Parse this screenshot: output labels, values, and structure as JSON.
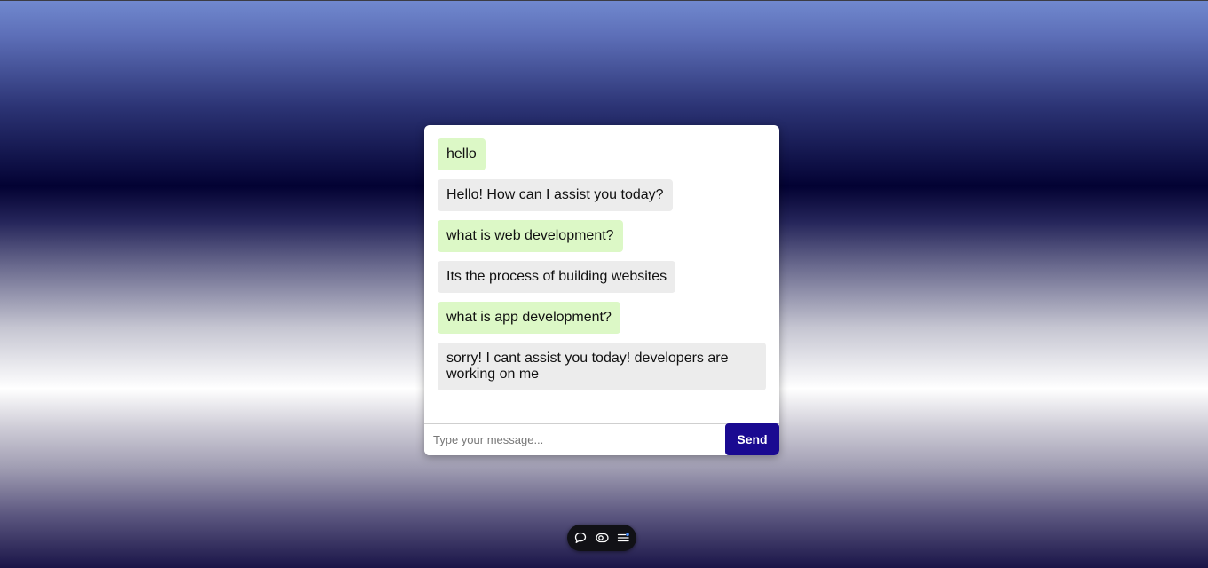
{
  "chat": {
    "messages": [
      {
        "role": "user",
        "text": "hello"
      },
      {
        "role": "bot",
        "text": "Hello! How can I assist you today?"
      },
      {
        "role": "user",
        "text": "what is web development?"
      },
      {
        "role": "bot",
        "text": "Its the process of building websites"
      },
      {
        "role": "user",
        "text": "what is app development?"
      },
      {
        "role": "bot",
        "text": "sorry! I cant assist you today! developers are working on me"
      }
    ],
    "input": {
      "placeholder": "Type your message...",
      "value": ""
    },
    "send_label": "Send"
  },
  "dock": {
    "icons": [
      "chat-bubble-icon",
      "toggle-icon",
      "list-settings-icon"
    ]
  },
  "colors": {
    "user_bubble": "#dcf8c6",
    "bot_bubble": "#ececec",
    "send_button": "#1a0a91",
    "dock_background": "#111116"
  }
}
